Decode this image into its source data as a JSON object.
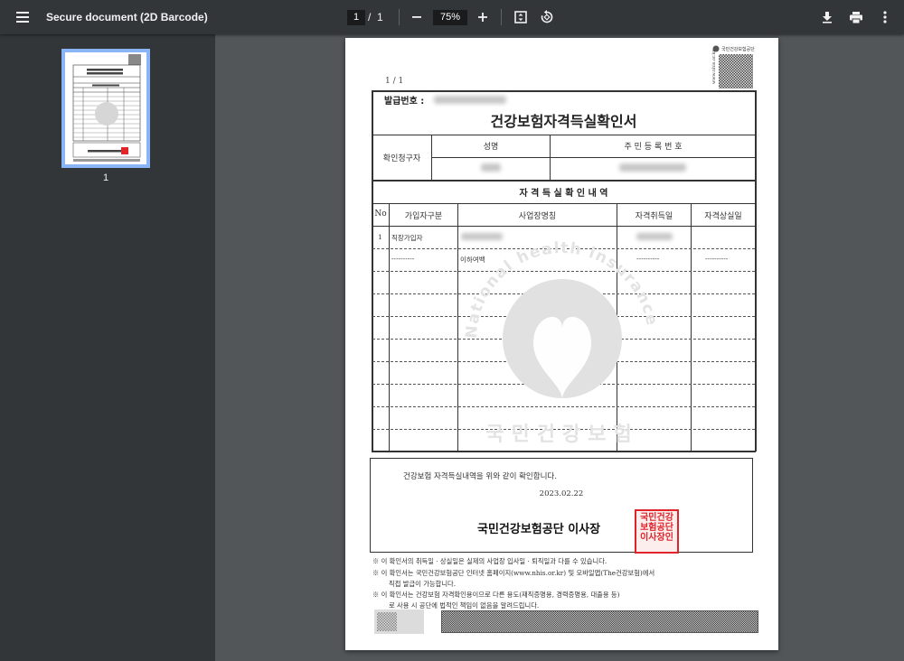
{
  "toolbar": {
    "title": "Secure document (2D Barcode)",
    "current_page": "1",
    "page_separator": "/",
    "total_pages": "1",
    "zoom": "75%"
  },
  "sidebar": {
    "thumbnail_label": "1"
  },
  "document": {
    "page_counter": "1 / 1",
    "issuer_logo_text": "국민건강보험공단",
    "issuer_url": "www.nhis.or.kr",
    "issue_no_label": "발급번호 :",
    "title": "건강보험자격득실확인서",
    "requester_label": "확인청구자",
    "name_header": "성명",
    "id_header": "주 민 등 록 번 호",
    "section_title": "자 격 득 실 확 인 내 역",
    "columns": [
      "No",
      "가입자구분",
      "사업장명칭",
      "자격취득일",
      "자격상실일"
    ],
    "row1": {
      "no": "1",
      "type": "직장가입자"
    },
    "row2": {
      "type": "----------",
      "workplace": "이하여백",
      "acquired": "----------",
      "lost": "----------"
    },
    "watermark_en": "National health insurance service",
    "watermark_ko": "국민건강보험",
    "confirm_text": "건강보험 자격득실내역을 위와 같이 확인합니다.",
    "date": "2023.02.22",
    "signer": "국민건강보험공단 이사장",
    "seal_text": "국민건강보험공단이사장인",
    "notes": [
      "※  이 확인서의 취득일 · 상실일은 실제의 사업장 입사일 · 퇴직일과 다를 수 있습니다.",
      "※  이 확인서는 국민건강보험공단 인터넷 홈페이지(www.nhis.or.kr) 및 모바일앱(The건강보험)에서",
      "직접 발급이 가능합니다.",
      "※  이 확인서는 건강보험 자격확인용이므로 다른 용도(재직증명용, 경력증명용, 대출용 등)",
      "로 사용 시 공단에 법적인 책임이 없음을 알려드립니다."
    ]
  },
  "colors": {
    "toolbar_bg": "#323639",
    "viewer_bg": "#525659",
    "thumb_border": "#8ab4f8",
    "seal_red": "#e0242a"
  }
}
